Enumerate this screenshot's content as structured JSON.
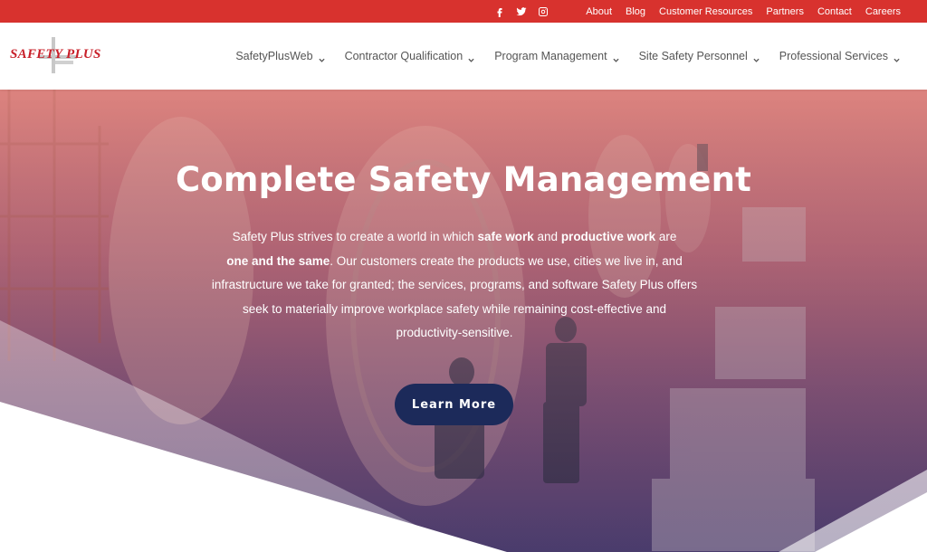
{
  "topbar": {
    "social": [
      "facebook-icon",
      "twitter-icon",
      "instagram-icon"
    ],
    "links": [
      "About",
      "Blog",
      "Customer Resources",
      "Partners",
      "Contact",
      "Careers"
    ],
    "color": "#d8322e"
  },
  "header": {
    "logo_text": "SAFETY PLUS",
    "nav": [
      {
        "label": "SafetyPlusWeb"
      },
      {
        "label": "Contractor Qualification"
      },
      {
        "label": "Program Management"
      },
      {
        "label": "Site Safety Personnel"
      },
      {
        "label": "Professional Services"
      }
    ]
  },
  "hero": {
    "title": "Complete Safety Management",
    "body": {
      "p1": "Safety Plus strives to create a world in which ",
      "b1": "safe work",
      "p2": " and ",
      "b2": "productive work",
      "p3": " are ",
      "b3": "one and the same",
      "p4": ". Our customers create the products we use, cities we live in, and infrastructure we take for granted; the services, programs, and software Safety Plus offers seek to materially improve workplace safety while remaining cost-effective and productivity-sensitive."
    },
    "cta_label": "Learn More",
    "cta_color": "#1c2a5a"
  }
}
